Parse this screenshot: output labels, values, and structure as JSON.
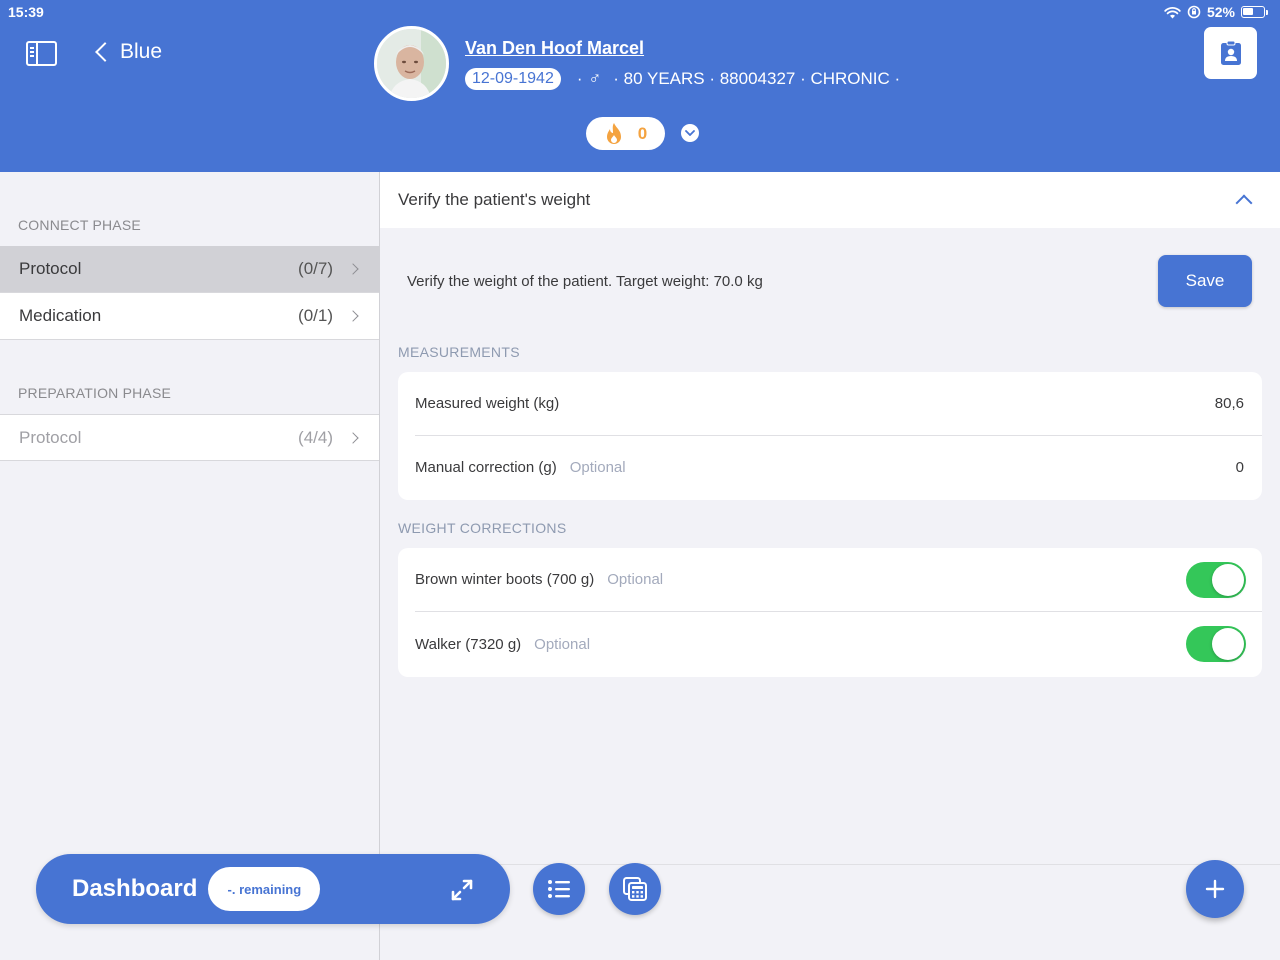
{
  "status_bar": {
    "time": "15:39",
    "battery": "52%"
  },
  "header": {
    "back_label": "Blue",
    "patient": {
      "name": "Van Den Hoof Marcel",
      "dob": "12-09-1942",
      "gender_symbol": "♂",
      "details": "· 80 YEARS · 88004327 · CHRONIC ·"
    },
    "flame_count": "0"
  },
  "sidebar": {
    "phases": [
      {
        "title": "CONNECT PHASE",
        "items": [
          {
            "label": "Protocol",
            "count": "(0/7)"
          },
          {
            "label": "Medication",
            "count": "(0/1)"
          }
        ]
      },
      {
        "title": "PREPARATION PHASE",
        "items": [
          {
            "label": "Protocol",
            "count": "(4/4)"
          }
        ]
      }
    ]
  },
  "main": {
    "step_title": "Verify the patient's weight",
    "instruction": "Verify the weight of the patient. Target weight: 70.0 kg",
    "save_label": "Save",
    "measurements": {
      "title": "MEASUREMENTS",
      "rows": [
        {
          "label": "Measured weight (kg)",
          "value": "80,6"
        },
        {
          "label": "Manual correction (g)",
          "optional": "Optional",
          "value": "0"
        }
      ]
    },
    "weight_corrections": {
      "title": "WEIGHT CORRECTIONS",
      "rows": [
        {
          "label": "Brown winter boots (700 g)",
          "optional": "Optional",
          "enabled": true
        },
        {
          "label": "Walker (7320 g)",
          "optional": "Optional",
          "enabled": true
        }
      ]
    }
  },
  "footer": {
    "dashboard_label": "Dashboard",
    "remaining_label": "-. remaining"
  },
  "colors": {
    "primary": "#4774d3",
    "toggle_on": "#34c759",
    "flame": "#f4a340"
  }
}
